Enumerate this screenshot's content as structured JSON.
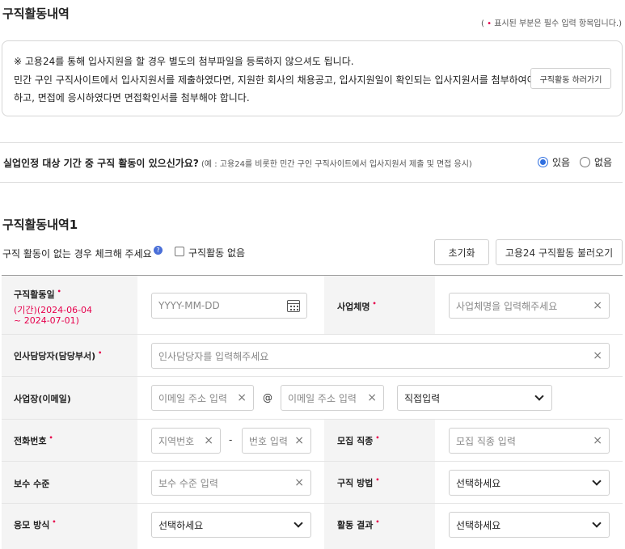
{
  "header": {
    "title": "구직활동내역",
    "required_note_prefix": "( ",
    "required_note_dot": "•",
    "required_note": " 표시된 부분은 필수 입력 항목입니다.)"
  },
  "notice": {
    "line1": "※ 고용24를 통해 입사지원을 할 경우 별도의 첨부파일을 등록하지 않으셔도 됩니다.",
    "line2": "민간 구인 구직사이트에서 입사지원서를 제출하였다면, 지원한 회사의 채용공고, 입사지원일이 확인되는 입사지원서를 첨부하여야",
    "line3": "하고, 면접에 응시하였다면 면접확인서를 첨부해야 합니다.",
    "button": "구직활동 하러가기"
  },
  "question": {
    "label": "실업인정 대상 기간 중 구직 활동이 있으신가요?",
    "sub": " (예 : 고용24를 비롯한 민간 구인 구직사이트에서 입사지원서 제출 및 면접 응시)",
    "options": [
      {
        "label": "있음",
        "selected": true
      },
      {
        "label": "없음",
        "selected": false
      }
    ]
  },
  "section": {
    "title": "구직활동내역1",
    "no_activity_text": "구직 활동이 없는 경우 체크해 주세요",
    "help_icon": "?",
    "checkbox_label": "구직활동 없음",
    "reset_button": "초기화",
    "load_button": "고용24 구직활동 불러오기"
  },
  "form": {
    "activity_date": {
      "label": "구직활동일",
      "period": "(기간)(2024-06-04",
      "period2": "~ 2024-07-01)",
      "placeholder": "YYYY-MM-DD"
    },
    "business_name": {
      "label": "사업체명",
      "placeholder": "사업체명을 입력해주세요"
    },
    "hr_manager": {
      "label": "인사담당자(담당부서)",
      "placeholder": "인사담당자를 입력해주세요"
    },
    "email": {
      "label": "사업장(이메일)",
      "placeholder_id": "이메일 주소 입력",
      "at": "@",
      "placeholder_domain": "이메일 주소 입력",
      "domain_select": "직접입력"
    },
    "phone": {
      "label": "전화번호",
      "placeholder_area": "지역번호",
      "dash": "-",
      "placeholder_number": "번호 입력"
    },
    "job_type": {
      "label": "모집 직종",
      "placeholder": "모집 직종 입력"
    },
    "salary": {
      "label": "보수 수준",
      "placeholder": "보수 수준 입력"
    },
    "method": {
      "label": "구직 방법",
      "value": "선택하세요"
    },
    "apply_type": {
      "label": "응모 방식",
      "value": "선택하세요"
    },
    "result": {
      "label": "활동 결과",
      "value": "선택하세요"
    }
  },
  "colors": {
    "required": "#e6004c",
    "radio_on": "#2f6fe0",
    "label_bg": "#f4f4f4"
  },
  "icons": {
    "clear": "×",
    "required": "•"
  }
}
